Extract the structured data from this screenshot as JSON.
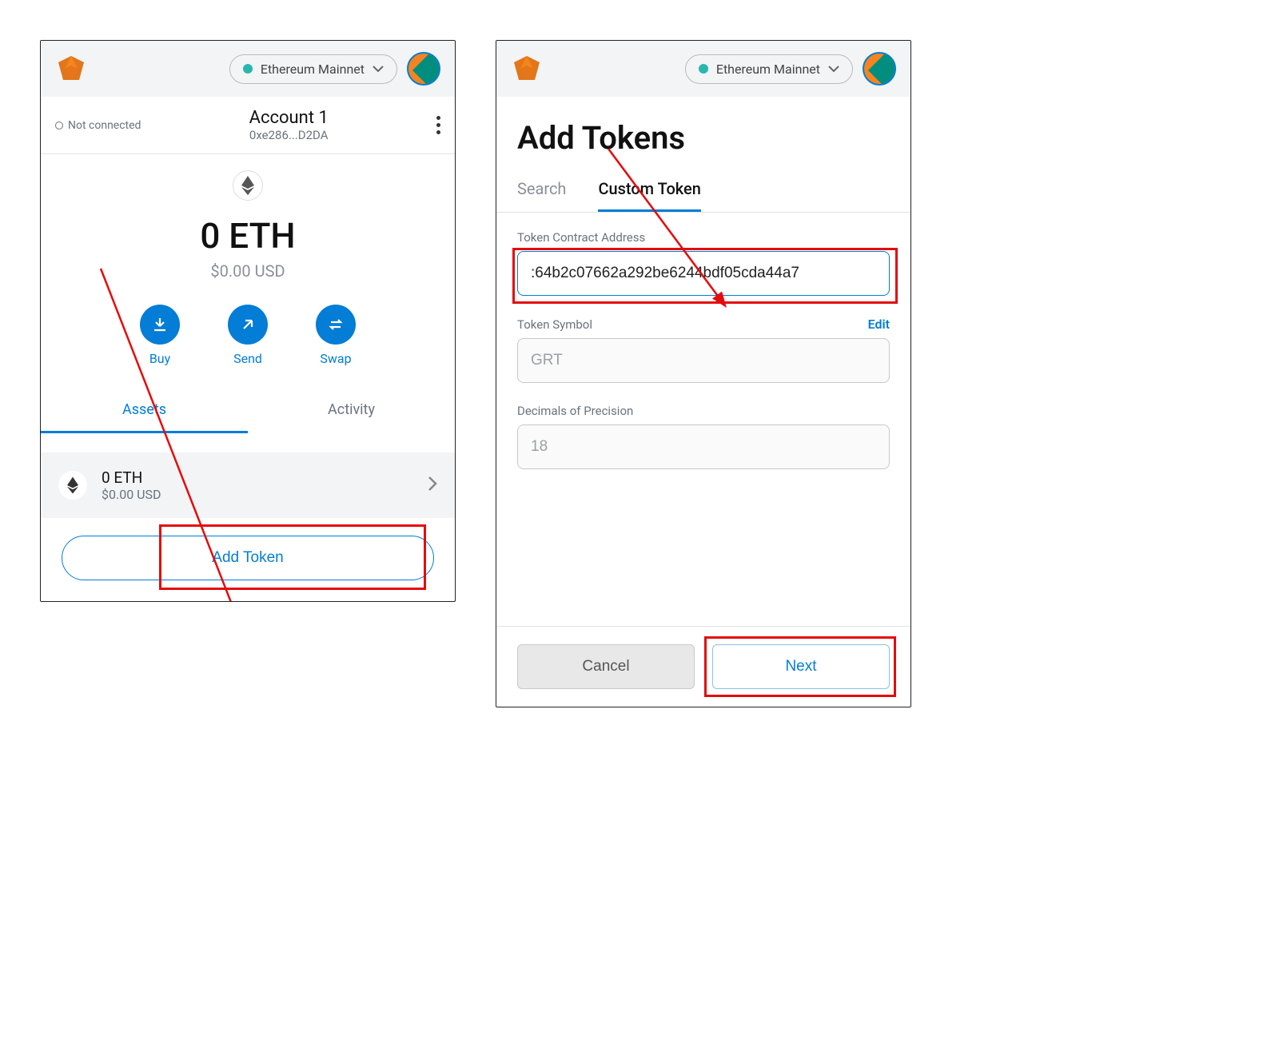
{
  "network": {
    "label": "Ethereum Mainnet"
  },
  "left": {
    "notConnected": "Not connected",
    "accountName": "Account 1",
    "accountAddr": "0xe286...D2DA",
    "balance": "0 ETH",
    "fiat": "$0.00 USD",
    "actions": {
      "buy": "Buy",
      "send": "Send",
      "swap": "Swap"
    },
    "tabs": {
      "assets": "Assets",
      "activity": "Activity"
    },
    "asset": {
      "amount": "0 ETH",
      "usd": "$0.00 USD"
    },
    "addToken": "Add Token"
  },
  "right": {
    "title": "Add Tokens",
    "tabs": {
      "search": "Search",
      "custom": "Custom Token"
    },
    "fields": {
      "contractLabel": "Token Contract Address",
      "contractValue": ":64b2c07662a292be6244bdf05cda44a7",
      "symbolLabel": "Token Symbol",
      "symbolEdit": "Edit",
      "symbolValue": "GRT",
      "decimalsLabel": "Decimals of Precision",
      "decimalsValue": "18"
    },
    "buttons": {
      "cancel": "Cancel",
      "next": "Next"
    }
  }
}
